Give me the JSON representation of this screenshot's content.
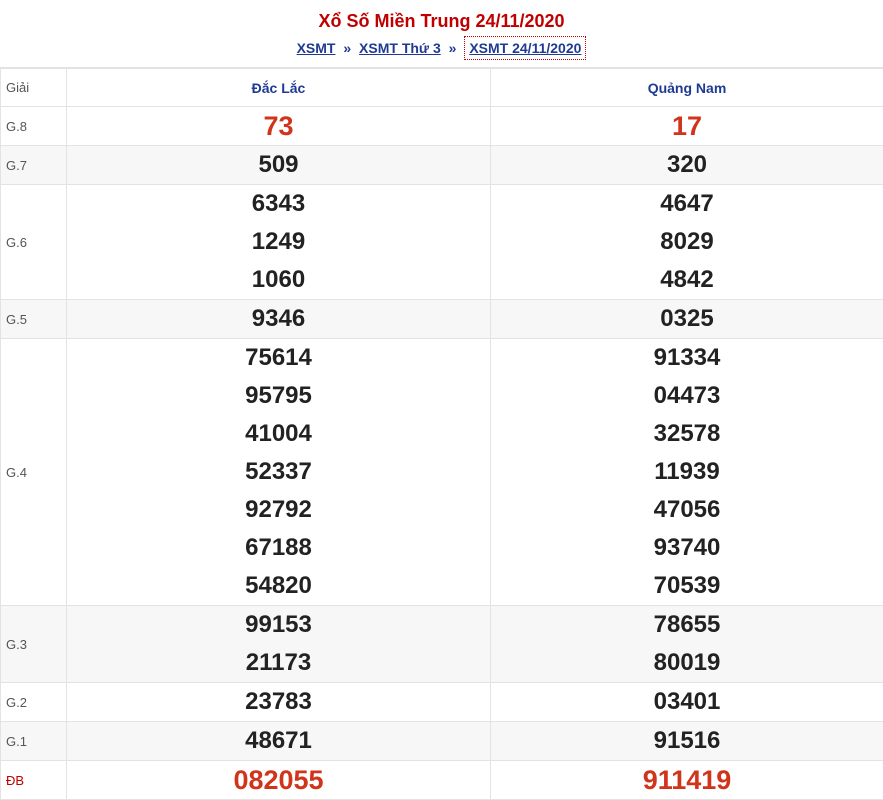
{
  "header": {
    "title": "Xổ Số Miền Trung 24/11/2020",
    "breadcrumb": [
      "XSMT",
      "XSMT Thứ 3",
      "XSMT 24/11/2020"
    ],
    "separator": "»"
  },
  "table": {
    "head_label": "Giải",
    "provinces": [
      "Đắc Lắc",
      "Quảng Nam"
    ],
    "rows": [
      {
        "label": "G.8",
        "a": [
          "73"
        ],
        "b": [
          "17"
        ]
      },
      {
        "label": "G.7",
        "a": [
          "509"
        ],
        "b": [
          "320"
        ]
      },
      {
        "label": "G.6",
        "a": [
          "6343",
          "1249",
          "1060"
        ],
        "b": [
          "4647",
          "8029",
          "4842"
        ]
      },
      {
        "label": "G.5",
        "a": [
          "9346"
        ],
        "b": [
          "0325"
        ]
      },
      {
        "label": "G.4",
        "a": [
          "75614",
          "95795",
          "41004",
          "52337",
          "92792",
          "67188",
          "54820"
        ],
        "b": [
          "91334",
          "04473",
          "32578",
          "11939",
          "47056",
          "93740",
          "70539"
        ]
      },
      {
        "label": "G.3",
        "a": [
          "99153",
          "21173"
        ],
        "b": [
          "78655",
          "80019"
        ]
      },
      {
        "label": "G.2",
        "a": [
          "23783"
        ],
        "b": [
          "03401"
        ]
      },
      {
        "label": "G.1",
        "a": [
          "48671"
        ],
        "b": [
          "91516"
        ]
      },
      {
        "label": "ĐB",
        "a": [
          "082055"
        ],
        "b": [
          "911419"
        ]
      }
    ]
  },
  "colors": {
    "title": "#c00000",
    "link": "#1f3a93",
    "highlight_number": "#d0341a",
    "alt_row": "#f7f7f7"
  }
}
